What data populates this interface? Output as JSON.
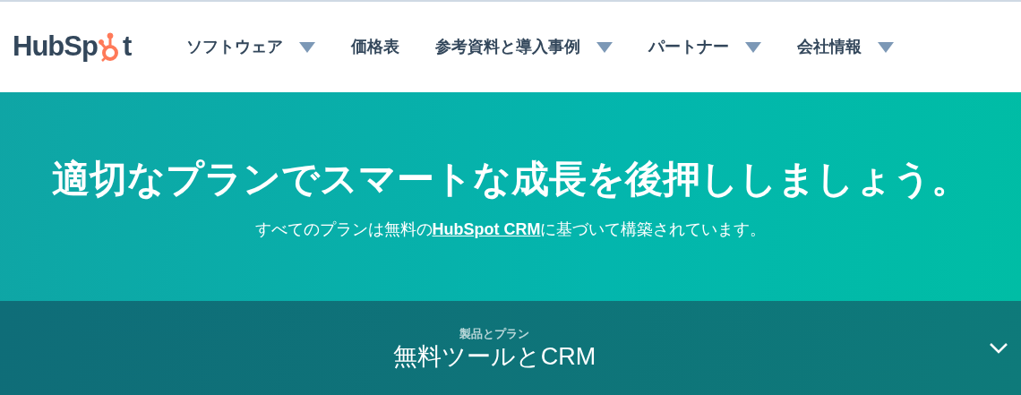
{
  "logo": {
    "text_start": "HubSp",
    "text_end": "t"
  },
  "nav": [
    {
      "label": "ソフトウェア",
      "has_menu": true
    },
    {
      "label": "価格表",
      "has_menu": false
    },
    {
      "label": "参考資料と導入事例",
      "has_menu": true
    },
    {
      "label": "パートナー",
      "has_menu": true
    },
    {
      "label": "会社情報",
      "has_menu": true
    }
  ],
  "hero": {
    "title": "適切なプランでスマートな成長を後押ししましょう。",
    "subtitle": {
      "before": "すべてのプランは無料の",
      "link": "HubSpot CRM",
      "after": "に基づいて構築されています。"
    }
  },
  "plan_selector": {
    "label": "製品とプラン",
    "value": "無料ツールとCRM",
    "expanded": false
  }
}
